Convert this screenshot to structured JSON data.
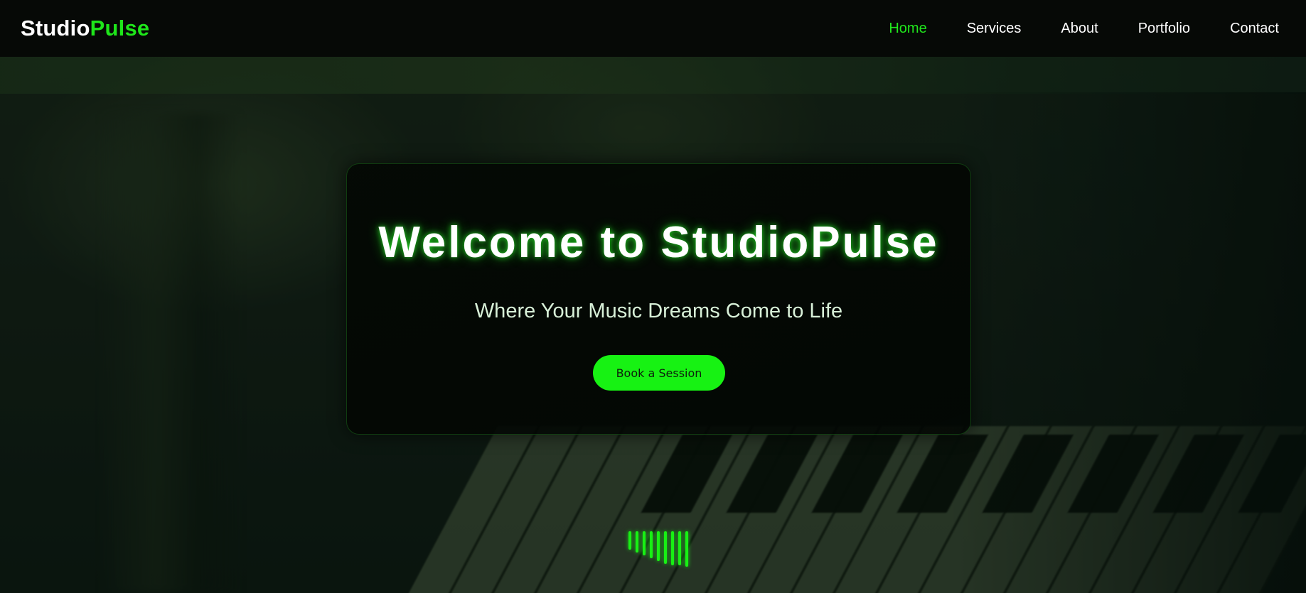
{
  "brand": {
    "name_part1": "Studio",
    "name_part2": "Pulse",
    "accent_color": "#1ee61a"
  },
  "nav": {
    "items": [
      {
        "label": "Home",
        "active": true
      },
      {
        "label": "Services",
        "active": false
      },
      {
        "label": "About",
        "active": false
      },
      {
        "label": "Portfolio",
        "active": false
      },
      {
        "label": "Contact",
        "active": false
      }
    ]
  },
  "hero": {
    "title": "Welcome to StudioPulse",
    "subtitle": "Where Your Music Dreams Come to Life",
    "cta_label": "Book a Session"
  },
  "equalizer": {
    "bar_count": 9,
    "color": "#18f014"
  }
}
